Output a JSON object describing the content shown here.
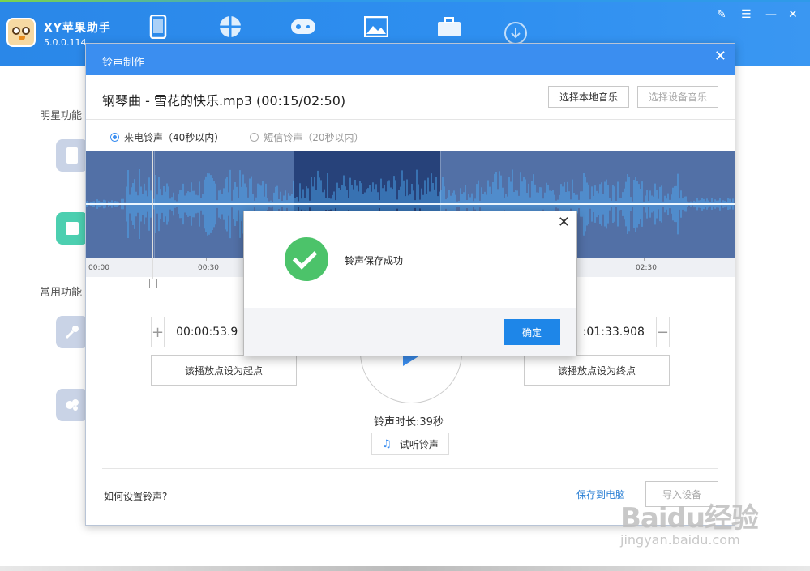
{
  "app": {
    "name": "XY苹果助手",
    "version": "5.0.0.114",
    "window_icons": [
      "pen-icon",
      "list-icon",
      "minimize-icon",
      "close-icon"
    ]
  },
  "sidebar": {
    "section1": "明星功能",
    "section2": "常用功能"
  },
  "dialog": {
    "title": "铃声制作",
    "file_name": "钢琴曲 - 雪花的快乐.mp3 (00:15/02:50)",
    "btn_local": "选择本地音乐",
    "btn_device": "选择设备音乐",
    "radio_call": "来电铃声（40秒以内）",
    "radio_sms": "短信铃声（20秒以内）",
    "ticks": [
      "00:00",
      "00:30",
      "02:30"
    ],
    "start_time": "00:00:53.9",
    "end_time": ":01:33.908",
    "set_start": "该播放点设为起点",
    "set_end": "该播放点设为终点",
    "duration": "铃声时长:39秒",
    "preview": "试听铃声",
    "help": "如何设置铃声?",
    "save_pc": "保存到电脑",
    "import": "导入设备"
  },
  "modal": {
    "message": "铃声保存成功",
    "ok": "确定"
  },
  "watermark": {
    "line1": "Baidu经验",
    "line2": "jingyan.baidu.com"
  },
  "colors": {
    "accent": "#3b8ef0",
    "success": "#4cc36a",
    "wave_bg": "#5270a6",
    "wave_sel": "#27427a"
  }
}
